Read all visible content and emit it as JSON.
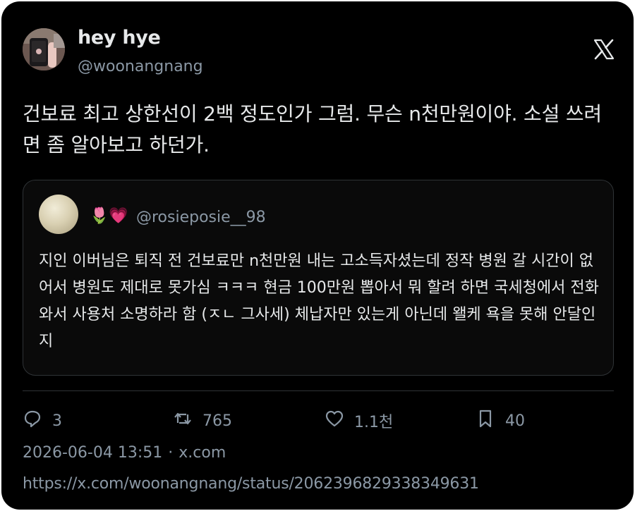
{
  "author": {
    "display_name": "hey hye",
    "handle": "@woonangnang"
  },
  "tweet": {
    "text": "건보료 최고 상한선이 2백 정도인가 그럼. 무슨 n천만원이야. 소설 쓰려면 좀 알아보고 하던가."
  },
  "quoted": {
    "emoji": "🌷💗",
    "handle": "@rosieposie__98",
    "text": "지인 이버님은 퇴직 전 건보료만 n천만원 내는 고소득자셨는데 정작 병원 갈 시간이 없어서 병원도 제대로 못가심 ㅋㅋㅋ 현금 100만원 뽑아서 뭐 할려 하면 국세청에서 전화 와서 사용처 소명하라 함 (ㅈㄴ 그사세) 체납자만 있는게 아닌데 왤케 욕을 못해 안달인지"
  },
  "actions": {
    "replies": "3",
    "reposts": "765",
    "likes": "1.1천",
    "bookmarks": "40"
  },
  "meta": {
    "timestamp": "2026-06-04 13:51",
    "separator": "·",
    "source": "x.com",
    "url": "https://x.com/woonangnang/status/2062396829338349631"
  },
  "icons": {
    "brand": "x-logo-icon",
    "reply": "reply-icon",
    "repost": "repost-icon",
    "like": "heart-icon",
    "bookmark": "bookmark-icon"
  },
  "colors": {
    "background": "#000000",
    "text": "#e7e9ea",
    "muted": "#8b98a5",
    "border": "#2f3336"
  }
}
